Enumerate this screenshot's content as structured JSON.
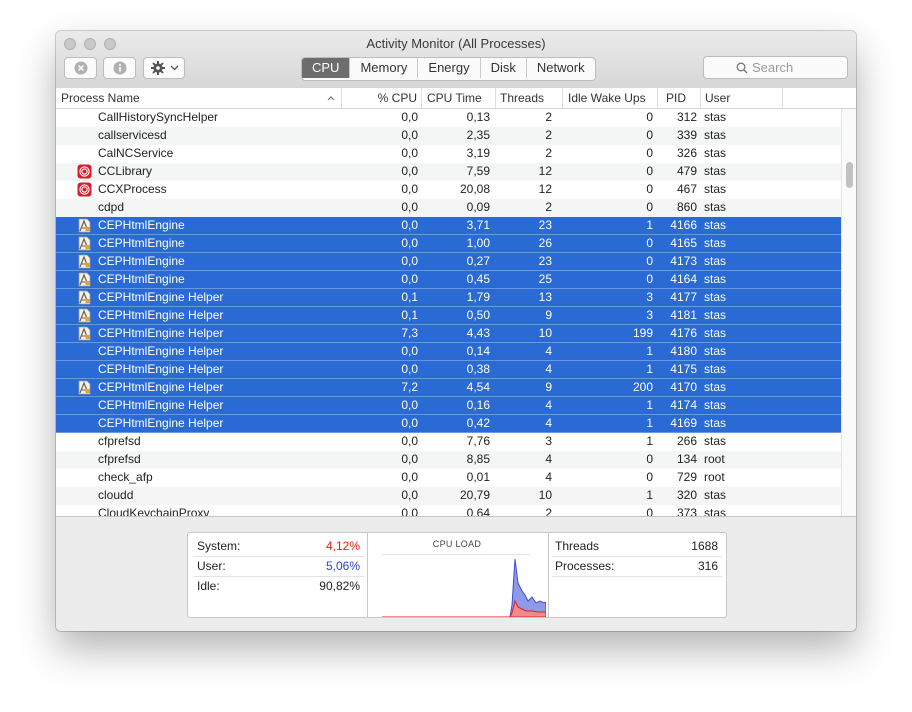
{
  "window": {
    "title": "Activity Monitor (All Processes)"
  },
  "toolbar": {
    "close_process_icon": "x-circle-icon",
    "info_icon": "info-icon",
    "action_icon": "gear-icon",
    "tabs": [
      {
        "label": "CPU",
        "active": true
      },
      {
        "label": "Memory",
        "active": false
      },
      {
        "label": "Energy",
        "active": false
      },
      {
        "label": "Disk",
        "active": false
      },
      {
        "label": "Network",
        "active": false
      }
    ],
    "search_placeholder": "Search"
  },
  "table": {
    "columns": [
      "Process Name",
      "% CPU",
      "CPU Time",
      "Threads",
      "Idle Wake Ups",
      "PID",
      "User"
    ],
    "rows": [
      {
        "name": "CallHistorySyncHelper",
        "cpu": "0,0",
        "time": "0,13",
        "threads": "2",
        "wakeups": "0",
        "pid": "312",
        "user": "stas",
        "icon": "",
        "selected": false
      },
      {
        "name": "callservicesd",
        "cpu": "0,0",
        "time": "2,35",
        "threads": "2",
        "wakeups": "0",
        "pid": "339",
        "user": "stas",
        "icon": "",
        "selected": false
      },
      {
        "name": "CalNCService",
        "cpu": "0,0",
        "time": "3,19",
        "threads": "2",
        "wakeups": "0",
        "pid": "326",
        "user": "stas",
        "icon": "",
        "selected": false
      },
      {
        "name": "CCLibrary",
        "cpu": "0,0",
        "time": "7,59",
        "threads": "12",
        "wakeups": "0",
        "pid": "479",
        "user": "stas",
        "icon": "creative-cloud-icon",
        "selected": false
      },
      {
        "name": "CCXProcess",
        "cpu": "0,0",
        "time": "20,08",
        "threads": "12",
        "wakeups": "0",
        "pid": "467",
        "user": "stas",
        "icon": "creative-cloud-icon",
        "selected": false
      },
      {
        "name": "cdpd",
        "cpu": "0,0",
        "time": "0,09",
        "threads": "2",
        "wakeups": "0",
        "pid": "860",
        "user": "stas",
        "icon": "",
        "selected": false
      },
      {
        "name": "CEPHtmlEngine",
        "cpu": "0,0",
        "time": "3,71",
        "threads": "23",
        "wakeups": "1",
        "pid": "4166",
        "user": "stas",
        "icon": "app-document-icon",
        "selected": true
      },
      {
        "name": "CEPHtmlEngine",
        "cpu": "0,0",
        "time": "1,00",
        "threads": "26",
        "wakeups": "0",
        "pid": "4165",
        "user": "stas",
        "icon": "app-document-icon",
        "selected": true
      },
      {
        "name": "CEPHtmlEngine",
        "cpu": "0,0",
        "time": "0,27",
        "threads": "23",
        "wakeups": "0",
        "pid": "4173",
        "user": "stas",
        "icon": "app-document-icon",
        "selected": true
      },
      {
        "name": "CEPHtmlEngine",
        "cpu": "0,0",
        "time": "0,45",
        "threads": "25",
        "wakeups": "0",
        "pid": "4164",
        "user": "stas",
        "icon": "app-document-icon",
        "selected": true
      },
      {
        "name": "CEPHtmlEngine Helper",
        "cpu": "0,1",
        "time": "1,79",
        "threads": "13",
        "wakeups": "3",
        "pid": "4177",
        "user": "stas",
        "icon": "app-document-icon",
        "selected": true
      },
      {
        "name": "CEPHtmlEngine Helper",
        "cpu": "0,1",
        "time": "0,50",
        "threads": "9",
        "wakeups": "3",
        "pid": "4181",
        "user": "stas",
        "icon": "app-document-icon",
        "selected": true
      },
      {
        "name": "CEPHtmlEngine Helper",
        "cpu": "7,3",
        "time": "4,43",
        "threads": "10",
        "wakeups": "199",
        "pid": "4176",
        "user": "stas",
        "icon": "app-document-icon",
        "selected": true
      },
      {
        "name": "CEPHtmlEngine Helper",
        "cpu": "0,0",
        "time": "0,14",
        "threads": "4",
        "wakeups": "1",
        "pid": "4180",
        "user": "stas",
        "icon": "",
        "selected": true
      },
      {
        "name": "CEPHtmlEngine Helper",
        "cpu": "0,0",
        "time": "0,38",
        "threads": "4",
        "wakeups": "1",
        "pid": "4175",
        "user": "stas",
        "icon": "",
        "selected": true
      },
      {
        "name": "CEPHtmlEngine Helper",
        "cpu": "7,2",
        "time": "4,54",
        "threads": "9",
        "wakeups": "200",
        "pid": "4170",
        "user": "stas",
        "icon": "app-document-icon",
        "selected": true
      },
      {
        "name": "CEPHtmlEngine Helper",
        "cpu": "0,0",
        "time": "0,16",
        "threads": "4",
        "wakeups": "1",
        "pid": "4174",
        "user": "stas",
        "icon": "",
        "selected": true
      },
      {
        "name": "CEPHtmlEngine Helper",
        "cpu": "0,0",
        "time": "0,42",
        "threads": "4",
        "wakeups": "1",
        "pid": "4169",
        "user": "stas",
        "icon": "",
        "selected": true
      },
      {
        "name": "cfprefsd",
        "cpu": "0,0",
        "time": "7,76",
        "threads": "3",
        "wakeups": "1",
        "pid": "266",
        "user": "stas",
        "icon": "",
        "selected": false
      },
      {
        "name": "cfprefsd",
        "cpu": "0,0",
        "time": "8,85",
        "threads": "4",
        "wakeups": "0",
        "pid": "134",
        "user": "root",
        "icon": "",
        "selected": false
      },
      {
        "name": "check_afp",
        "cpu": "0,0",
        "time": "0,01",
        "threads": "4",
        "wakeups": "0",
        "pid": "729",
        "user": "root",
        "icon": "",
        "selected": false
      },
      {
        "name": "cloudd",
        "cpu": "0,0",
        "time": "20,79",
        "threads": "10",
        "wakeups": "1",
        "pid": "320",
        "user": "stas",
        "icon": "",
        "selected": false
      },
      {
        "name": "CloudKeychainProxy",
        "cpu": "0,0",
        "time": "0,64",
        "threads": "2",
        "wakeups": "0",
        "pid": "373",
        "user": "stas",
        "icon": "",
        "selected": false
      }
    ]
  },
  "summary": {
    "system_label": "System:",
    "system_value": "4,12%",
    "user_label": "User:",
    "user_value": "5,06%",
    "idle_label": "Idle:",
    "idle_value": "90,82%",
    "cpu_load_title": "CPU LOAD",
    "threads_label": "Threads",
    "threads_value": "1688",
    "processes_label": "Processes:",
    "processes_value": "316"
  },
  "colors": {
    "selection": "#2a6ad4",
    "system": "#e0201b",
    "user": "#2b3fd1"
  }
}
